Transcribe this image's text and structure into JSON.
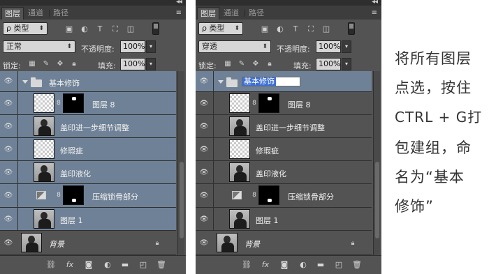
{
  "panel_left": {
    "tabs": [
      "图层",
      "通道",
      "路径"
    ],
    "filter_label": "ρ 类型",
    "blend_mode": "正常",
    "opacity_label": "不透明度:",
    "opacity_value": "100%",
    "lock_label": "锁定:",
    "fill_label": "填充:",
    "fill_value": "100%",
    "layers": [
      {
        "name": "基本修饰",
        "type": "group"
      },
      {
        "name": "图层 8",
        "type": "masked"
      },
      {
        "name": "盖印进一步细节调整",
        "type": "photo"
      },
      {
        "name": "修瑕疵",
        "type": "checker"
      },
      {
        "name": "盖印液化",
        "type": "photo"
      },
      {
        "name": "压缩锁骨部分",
        "type": "adjustment"
      },
      {
        "name": "图层 1",
        "type": "photo"
      },
      {
        "name": "背景",
        "type": "background"
      }
    ]
  },
  "panel_right": {
    "tabs": [
      "图层",
      "通道",
      "路径"
    ],
    "filter_label": "ρ 类型",
    "blend_mode": "穿透",
    "opacity_label": "不透明度:",
    "opacity_value": "100%",
    "lock_label": "锁定:",
    "fill_label": "填充:",
    "fill_value": "100%",
    "group_name_editing": "基本修饰",
    "layers": [
      {
        "name": "图层 8",
        "type": "masked"
      },
      {
        "name": "盖印进一步细节调整",
        "type": "photo"
      },
      {
        "name": "修瑕疵",
        "type": "checker"
      },
      {
        "name": "盖印液化",
        "type": "photo"
      },
      {
        "name": "压缩锁骨部分",
        "type": "adjustment"
      },
      {
        "name": "图层 1",
        "type": "photo"
      },
      {
        "name": "背景",
        "type": "background"
      }
    ]
  },
  "icons": {
    "eye": "eye-icon",
    "link": "link-icon",
    "fx": "fx-icon",
    "mask": "mask-icon",
    "adjustment": "adjustment-icon",
    "folder": "folder-icon",
    "new_layer": "new-layer-icon",
    "trash": "trash-icon",
    "lock": "lock-icon"
  },
  "bottom_fx_label": "fx",
  "caption": {
    "lines": [
      "将所有图层",
      "点选，按住",
      "CTRL + G打",
      "包建组，命",
      "名为“基本",
      "修饰”"
    ]
  },
  "colors": {
    "panel_bg": "#535353",
    "selected_row": "#6f8196",
    "caption_text": "#333333"
  }
}
